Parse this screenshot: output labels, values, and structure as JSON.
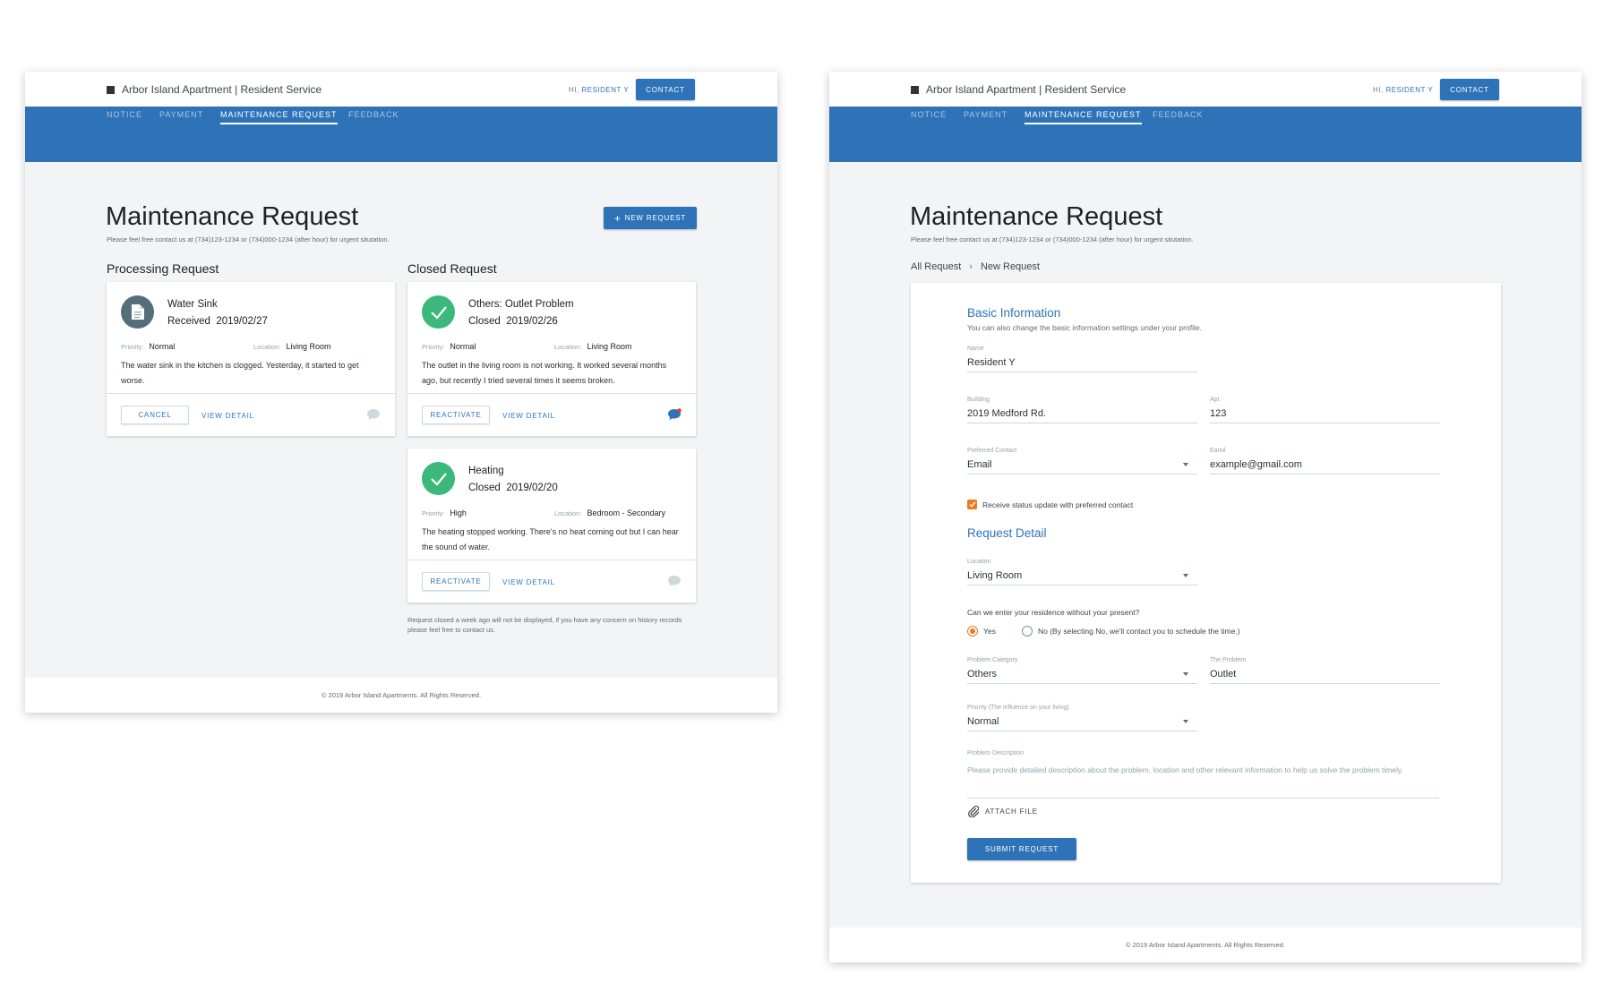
{
  "app": {
    "brand": "Arbor Island Apartment | Resident Service",
    "greeting_prefix": "HI,",
    "user_name": "RESIDENT Y",
    "contact_label": "CONTACT",
    "nav": [
      "NOTICE",
      "PAYMENT",
      "MAINTENANCE REQUEST",
      "FEEDBACK"
    ],
    "active_nav": "MAINTENANCE REQUEST",
    "footer": "© 2019 Arbor Island Apartments. All Rights Reserved.",
    "accent_color": "#2e73b8"
  },
  "page": {
    "title": "Maintenance Request",
    "subtitle": "Please feel free contact us at (734)123-1234 or (734)000-1234 (after hour) for urgent situtation."
  },
  "list_view": {
    "new_request_label": "NEW REQUEST",
    "processing_title": "Processing Request",
    "closed_title": "Closed Request",
    "priority_key": "Priority:",
    "location_key": "Location:",
    "view_detail_label": "VIEW DETAIL",
    "processing": [
      {
        "title": "Water Sink",
        "status": "Received",
        "date": "2019/02/27",
        "priority": "Normal",
        "location": "Living Room",
        "description": "The water sink in the kitchen is clogged. Yesterday, it started to get worse.",
        "action_label": "CANCEL",
        "icon": "document-icon"
      }
    ],
    "closed": [
      {
        "title": "Others: Outlet Problem",
        "status": "Closed",
        "date": "2019/02/26",
        "priority": "Normal",
        "location": "Living Room",
        "description": "The outlet in the living room is not working. It worked several months ago, but recently I tried several times it seems broken.",
        "action_label": "REACTIVATE",
        "icon": "check-icon",
        "unread_message": true
      },
      {
        "title": "Heating",
        "status": "Closed",
        "date": "2019/02/20",
        "priority": "High",
        "location": "Bedroom - Secondary",
        "description": "The heating stopped working. There's no heat coming out but I can hear the sound of water.",
        "action_label": "REACTIVATE",
        "icon": "check-icon",
        "unread_message": false
      }
    ],
    "closed_note": "Request closed a week ago will not be displayed, if you have any concern on history records please feel free to contact us."
  },
  "form_view": {
    "breadcrumb": [
      "All Request",
      "New Request"
    ],
    "basic_title": "Basic Information",
    "basic_sub": "You can also change the basic information settings under your profile.",
    "name": {
      "label": "Name",
      "value": "Resident Y"
    },
    "building": {
      "label": "Building",
      "value": "2019 Medford Rd."
    },
    "apt": {
      "label": "Apt",
      "value": "123"
    },
    "preferred_contact": {
      "label": "Preferred Contact",
      "value": "Email"
    },
    "email": {
      "label": "Eamil",
      "value": "example@gmail.com"
    },
    "status_update_checkbox": {
      "label": "Receive status update with preferred contact",
      "checked": true
    },
    "detail_title": "Request Detail",
    "location": {
      "label": "Location",
      "value": "Living Room"
    },
    "entry_question": "Can we enter your residence without your present?",
    "entry_options": [
      {
        "label": "Yes",
        "selected": true
      },
      {
        "label": "No (By selecting No, we'll contact you to schedule the time.)",
        "selected": false
      }
    ],
    "problem_category": {
      "label": "Problem Category",
      "value": "Others"
    },
    "the_problem": {
      "label": "The Problem",
      "value": "Outlet"
    },
    "priority": {
      "label": "Priority (The influence on your living)",
      "value": "Normal"
    },
    "problem_description": {
      "label": "Problem Description",
      "placeholder": "Please provide detailed description about the problem, location and other relevant information to help us solve the problem timely."
    },
    "attach_label": "ATTACH FILE",
    "submit_label": "SUBMIT REQUEST"
  }
}
